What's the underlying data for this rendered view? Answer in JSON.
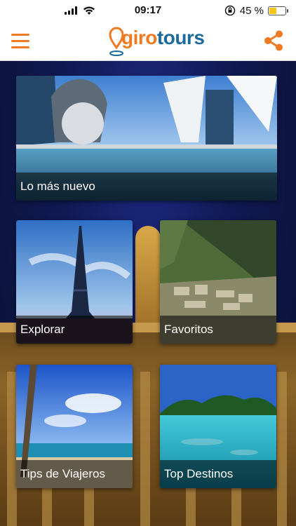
{
  "status_bar": {
    "time": "09:17",
    "battery_percent": "45 %",
    "battery_level": 0.45
  },
  "app_bar": {
    "logo": {
      "part1": "giro",
      "part2": "tours"
    },
    "menu_icon": "hamburger-menu-icon",
    "share_icon": "share-icon"
  },
  "colors": {
    "brand_orange": "#ef7a22",
    "brand_blue": "#1d6a9c"
  },
  "tiles": [
    {
      "label": "Lo más nuevo"
    },
    {
      "label": "Explorar"
    },
    {
      "label": "Favoritos"
    },
    {
      "label": "Tips de Viajeros"
    },
    {
      "label": "Top Destinos"
    }
  ]
}
